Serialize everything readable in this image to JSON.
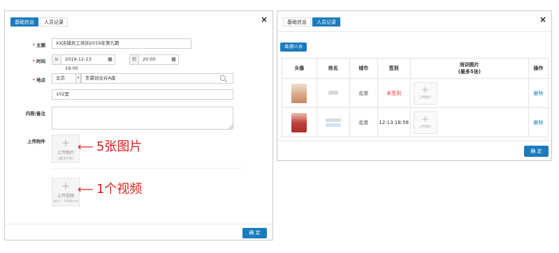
{
  "left": {
    "tabs": [
      "基础信息",
      "人员记录"
    ],
    "close_icon": "×",
    "fields": {
      "subject_label": "主题",
      "subject_value": "XX店铺员工培训2019年第九期",
      "time_label": "时间",
      "from_label": "从",
      "from_value": "2019-12-13 19:00",
      "to_label": "到",
      "to_value": "20:00",
      "location_label": "地点",
      "city_value": "北京",
      "address_value": "东甫创业谷A座",
      "room_value": "102室",
      "notes_label": "内容/备注",
      "attach_label": "上传附件"
    },
    "upload_image": {
      "line1": "上传图片",
      "line2": "(最多5张)"
    },
    "upload_video": {
      "line1": "上传视频",
      "line2": "(限1个，50MB以内)"
    },
    "annotation_image": "5张图片",
    "annotation_video": "1个视频",
    "confirm": "确 定"
  },
  "right": {
    "tabs": [
      "基础信息",
      "人员记录"
    ],
    "close_icon": "×",
    "add_button": "增/删人员",
    "columns": [
      "头像",
      "姓名",
      "城市",
      "签到",
      "培训图片",
      "(最多5张)",
      "操作"
    ],
    "rows": [
      {
        "city": "北京",
        "checkin": "未签到",
        "upload": "上传图片",
        "action": "删除"
      },
      {
        "city": "北京",
        "checkin": "12-13 18:58",
        "upload": "上传图片",
        "action": "删除"
      }
    ],
    "confirm": "确 定"
  },
  "colors": {
    "accent": "#1a7bbd",
    "required": "#e4393c",
    "annotation": "#e3211c"
  }
}
